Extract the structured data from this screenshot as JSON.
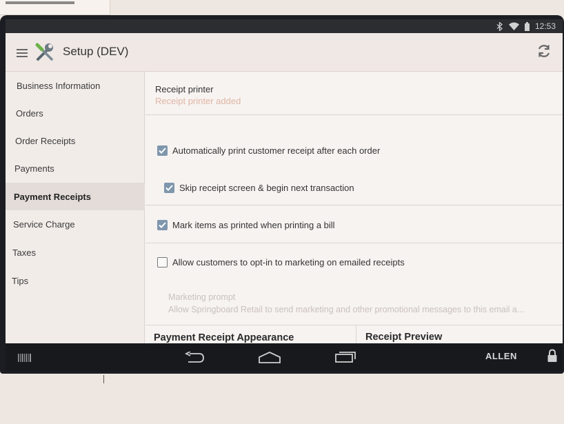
{
  "status_bar": {
    "time": "12:53",
    "icons": [
      "bluetooth-icon",
      "wifi-icon",
      "battery-icon"
    ]
  },
  "app_bar": {
    "title": "Setup (DEV)",
    "icons": [
      "menu-icon",
      "tools-logo-icon",
      "refresh-icon"
    ]
  },
  "sidebar": {
    "items": [
      {
        "label": "Business Information",
        "active": false
      },
      {
        "label": "Orders",
        "active": false
      },
      {
        "label": "Order Receipts",
        "active": false
      },
      {
        "label": "Payments",
        "active": false
      },
      {
        "label": "Payment Receipts",
        "active": true
      },
      {
        "label": "Service Charge",
        "active": false
      },
      {
        "label": "Taxes",
        "active": false
      },
      {
        "label": "Tips",
        "active": false
      }
    ]
  },
  "main": {
    "printer": {
      "title": "Receipt printer",
      "subtitle": "Receipt printer added"
    },
    "options": [
      {
        "label": "Automatically print customer receipt after each order",
        "checked": true
      },
      {
        "label": "Skip receipt screen & begin next transaction",
        "checked": true
      },
      {
        "label": "Mark items as printed when printing a bill",
        "checked": true
      },
      {
        "label": "Allow customers to opt-in to marketing on emailed receipts",
        "checked": false
      }
    ],
    "marketing": {
      "title": "Marketing prompt",
      "text": "Allow Springboard Retail to send marketing and other promotional messages to this email a..."
    },
    "sections": {
      "appearance": "Payment Receipt Appearance",
      "preview": "Receipt Preview"
    }
  },
  "nav_bar": {
    "user": "ALLEN",
    "icons": [
      "barcode-icon",
      "back-icon",
      "home-icon",
      "recents-icon",
      "lock-icon"
    ]
  },
  "colors": {
    "accent": "#7f97ad",
    "subtitle": "#e0b5a5",
    "navbar": "#17191d"
  }
}
